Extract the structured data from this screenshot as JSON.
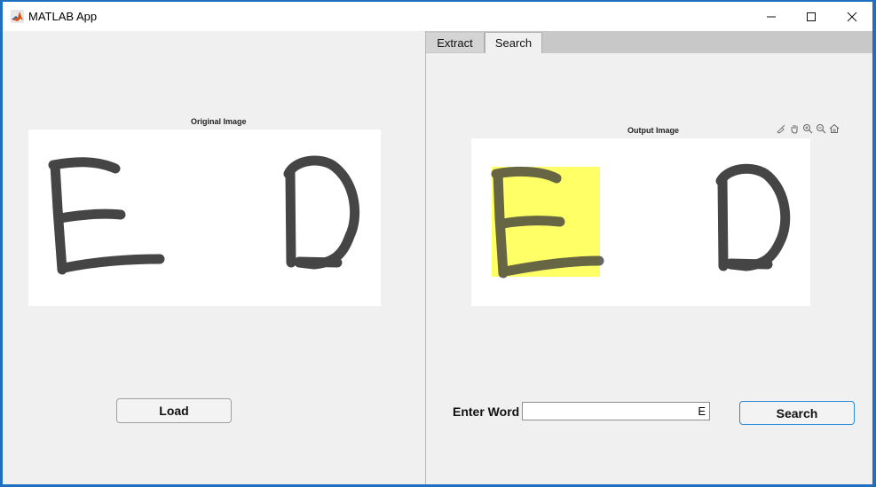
{
  "window": {
    "title": "MATLAB App"
  },
  "left_panel": {
    "axes_title": "Original Image",
    "load_label": "Load",
    "letters": [
      "E",
      "D"
    ]
  },
  "right_panel": {
    "tabs": [
      {
        "label": "Extract",
        "selected": false
      },
      {
        "label": "Search",
        "selected": true
      }
    ],
    "axes_title": "Output Image",
    "toolbar_icons": [
      "brush-icon",
      "pan-icon",
      "zoom-in-icon",
      "zoom-out-icon",
      "home-icon"
    ],
    "enter_word_label": "Enter Word",
    "word_value": "E",
    "search_label": "Search",
    "letters": [
      "E",
      "D"
    ],
    "highlighted_letter": "E",
    "highlight_color": "#ffff66"
  },
  "colors": {
    "titlebar": "#ffffff",
    "panel_bg": "#f0f0f0",
    "border_blue": "#1f6fc0",
    "ink": "#3c3c3c",
    "matlab_orange": "#d95319"
  }
}
